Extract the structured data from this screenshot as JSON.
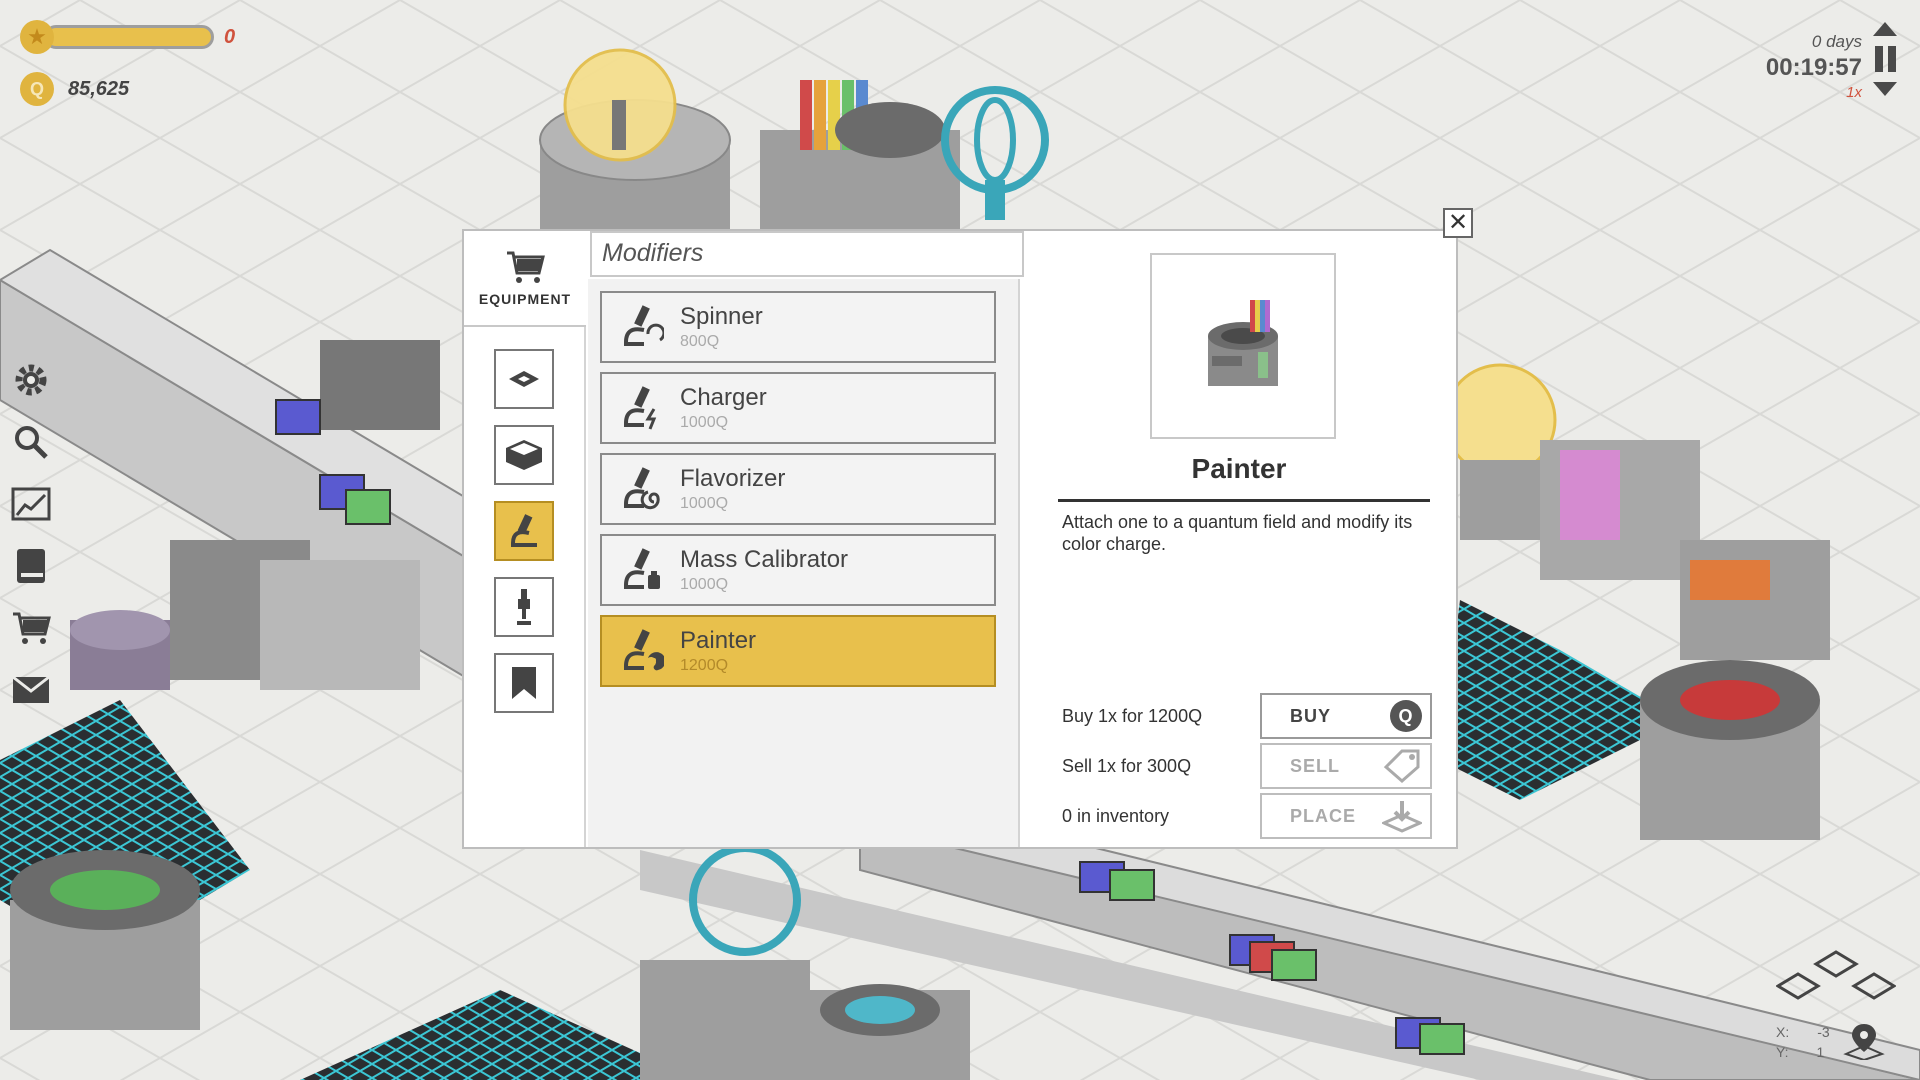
{
  "hud": {
    "xp_value": "0",
    "money": "85,625",
    "coin_symbol": "Q",
    "days": "0 days",
    "clock": "00:19:57",
    "speed": "1x"
  },
  "left_tools": [
    "gear-icon",
    "magnifier-icon",
    "chart-icon",
    "book-icon",
    "cart-icon",
    "mail-icon"
  ],
  "modal": {
    "equipment_label": "EQUIPMENT",
    "search_text": "Modifiers",
    "categories": [
      "conveyor",
      "box",
      "microscope",
      "pipette",
      "bookmark"
    ],
    "active_category": 2,
    "items": [
      {
        "name": "Spinner",
        "price": "800Q"
      },
      {
        "name": "Charger",
        "price": "1000Q"
      },
      {
        "name": "Flavorizer",
        "price": "1000Q"
      },
      {
        "name": "Mass Calibrator",
        "price": "1000Q"
      },
      {
        "name": "Painter",
        "price": "1200Q"
      }
    ],
    "selected_item": 4,
    "detail": {
      "title": "Painter",
      "description": "Attach one to a quantum field and modify its color charge.",
      "buy_text": "Buy 1x for 1200Q",
      "sell_text": "Sell 1x for 300Q",
      "inventory_text": "0 in inventory",
      "buy_label": "BUY",
      "sell_label": "SELL",
      "place_label": "PLACE"
    },
    "close_label": "✕"
  },
  "coords": {
    "x_label": "X:",
    "x": "-3",
    "y_label": "Y:",
    "y": "1"
  },
  "colors": {
    "accent": "#e8c04c",
    "alert": "#d0523d",
    "grid": "#3bc6d4",
    "machine": "#9e9e9e"
  }
}
